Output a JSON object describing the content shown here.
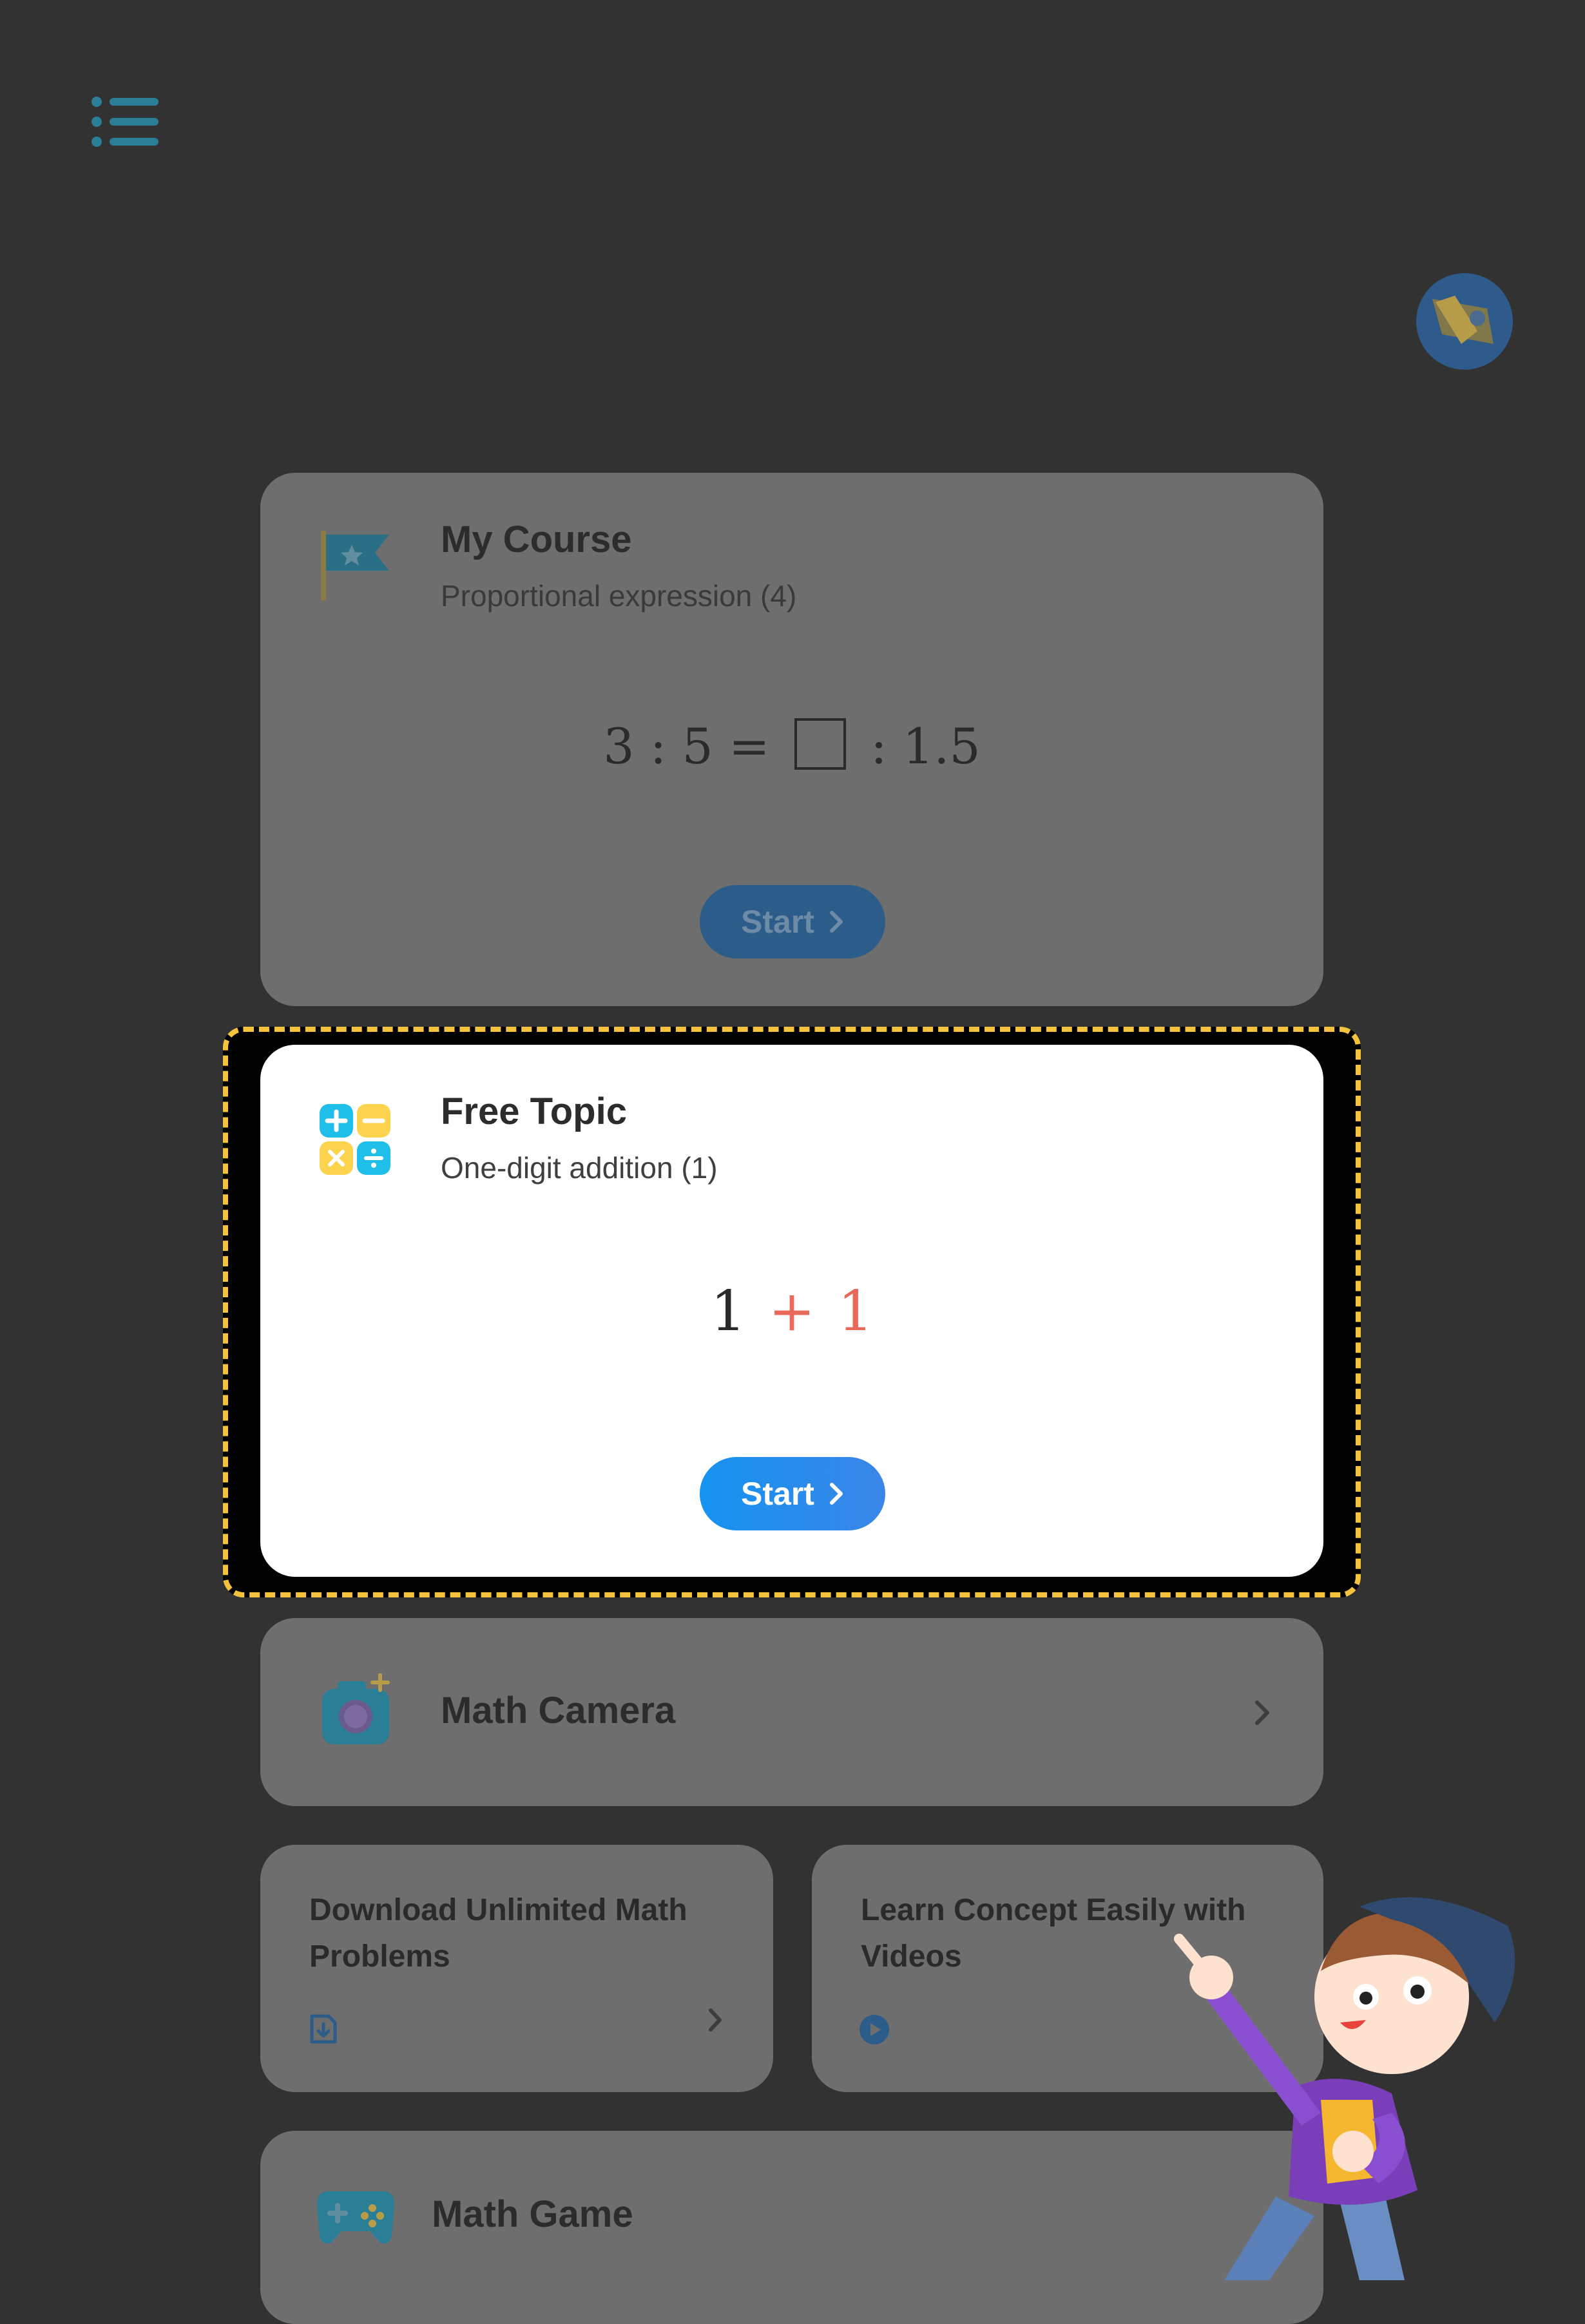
{
  "my_course": {
    "title": "My Course",
    "subtitle": "Proportional expression (4)",
    "formula_left": "3 : 5 =",
    "formula_right": ": 1.5",
    "start_label": "Start"
  },
  "free_topic": {
    "title": "Free Topic",
    "subtitle": "One-digit addition (1)",
    "formula_a": "1",
    "formula_op": "+",
    "formula_b": "1",
    "start_label": "Start"
  },
  "math_camera": {
    "title": "Math Camera"
  },
  "download_tile": {
    "title": "Download Unlimited Math Problems"
  },
  "videos_tile": {
    "title": "Learn Concept Easily with Videos"
  },
  "math_game": {
    "title": "Math Game"
  },
  "colors": {
    "background": "#323232",
    "dim_card": "#6e6e6e",
    "highlight_border": "#f4c23c",
    "primary_button": "#1592f0",
    "accent_red": "#e8685a",
    "icon_teal": "#2a7f96"
  },
  "icons": [
    "menu-icon",
    "avatar",
    "flag-icon",
    "calculator-icon",
    "camera-icon",
    "download-icon",
    "play-icon",
    "gamepad-icon",
    "chevron-right-icon"
  ]
}
